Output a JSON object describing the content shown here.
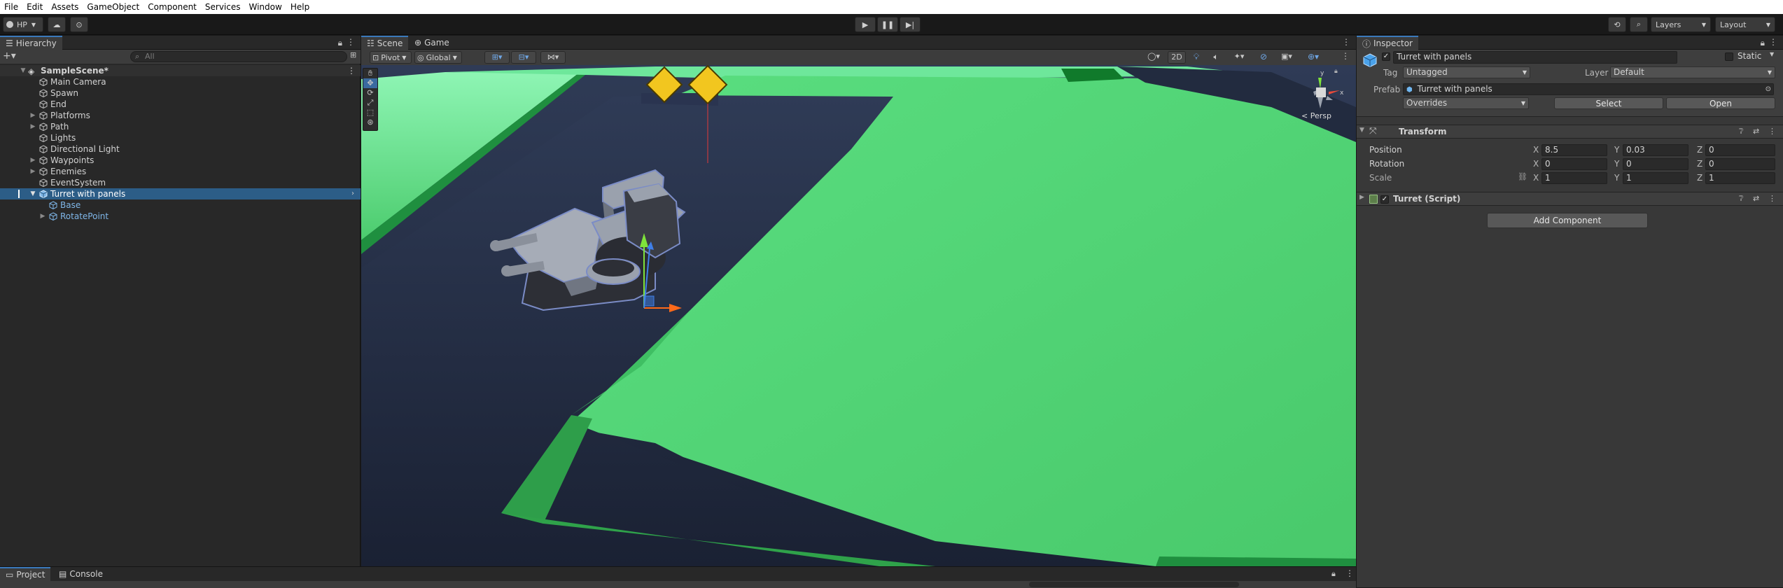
{
  "menu": [
    "File",
    "Edit",
    "Assets",
    "GameObject",
    "Component",
    "Services",
    "Window",
    "Help"
  ],
  "toolbar": {
    "account_label": "HP",
    "layers_label": "Layers",
    "layout_label": "Layout"
  },
  "hierarchy": {
    "tab_label": "Hierarchy",
    "search_placeholder": "All",
    "scene_name": "SampleScene*",
    "items": [
      {
        "label": "Main Camera"
      },
      {
        "label": "Spawn"
      },
      {
        "label": "End"
      },
      {
        "label": "Platforms"
      },
      {
        "label": "Path"
      },
      {
        "label": "Lights"
      },
      {
        "label": "Directional Light"
      },
      {
        "label": "Waypoints"
      },
      {
        "label": "Enemies"
      },
      {
        "label": "EventSystem"
      },
      {
        "label": "Turret with panels"
      },
      {
        "label": "Base"
      },
      {
        "label": "RotatePoint"
      }
    ]
  },
  "scene_view": {
    "tabs": [
      "Scene",
      "Game"
    ],
    "pivot_label": "Pivot",
    "global_label": "Global",
    "mode_2d_label": "2D",
    "persp_label": "< Persp"
  },
  "inspector": {
    "tab_label": "Inspector",
    "object_name": "Turret with panels",
    "static_label": "Static",
    "tag_label": "Tag",
    "tag_value": "Untagged",
    "layer_label": "Layer",
    "layer_value": "Default",
    "prefab_label": "Prefab",
    "prefab_value": "Turret with panels",
    "overrides_label": "Overrides",
    "select_label": "Select",
    "open_label": "Open",
    "transform_title": "Transform",
    "position_label": "Position",
    "rotation_label": "Rotation",
    "scale_label": "Scale",
    "x_label": "X",
    "y_label": "Y",
    "z_label": "Z",
    "position": {
      "x": "8.5",
      "y": "0.03",
      "z": "0"
    },
    "rotation": {
      "x": "0",
      "y": "0",
      "z": "0"
    },
    "scale": {
      "x": "1",
      "y": "1",
      "z": "1"
    },
    "script_title": "Turret (Script)",
    "add_component_label": "Add Component"
  },
  "bottom": {
    "project_tab": "Project",
    "console_tab": "Console"
  },
  "colors": {
    "accent_blue": "#2c5d87",
    "ground_green": "#4fd474",
    "path_navy": "#252f44"
  }
}
